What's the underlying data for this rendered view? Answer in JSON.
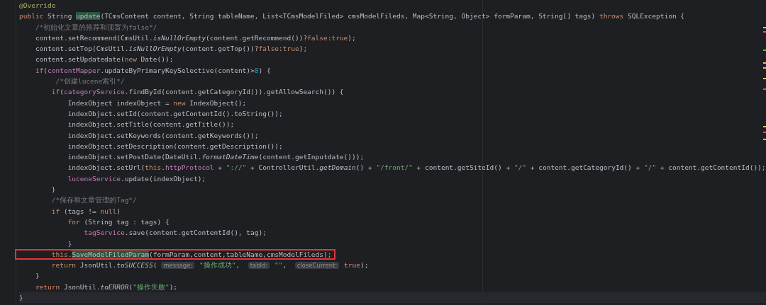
{
  "editor": {
    "lines": [
      {
        "boxed": false,
        "tokens": [
          {
            "kind": "annotation",
            "text": "@Override"
          }
        ]
      },
      {
        "boxed": false,
        "tokens": [
          {
            "kind": "keyword",
            "text": "public "
          },
          {
            "kind": "plain",
            "text": "String "
          },
          {
            "kind": "match",
            "text": "update"
          },
          {
            "kind": "plain",
            "text": "(TCmsContent content, String tableName, List<TCmsModelFiled> cmsModelFileds, Map<String, Object> formParam, String[] tags) "
          },
          {
            "kind": "keyword",
            "text": "throws "
          },
          {
            "kind": "plain",
            "text": "SQLException {"
          }
        ]
      },
      {
        "boxed": false,
        "tokens": [
          {
            "kind": "comment",
            "text": "    /*初始化文章的推荐和顶置为false*/"
          }
        ]
      },
      {
        "boxed": false,
        "tokens": [
          {
            "kind": "plain",
            "text": "    content.setRecommend(CmsUtil."
          },
          {
            "kind": "static",
            "text": "isNullOrEmpty"
          },
          {
            "kind": "plain",
            "text": "(content.getRecommend())?"
          },
          {
            "kind": "keyword",
            "text": "false"
          },
          {
            "kind": "plain",
            "text": ":"
          },
          {
            "kind": "keyword",
            "text": "true"
          },
          {
            "kind": "plain",
            "text": ");"
          }
        ]
      },
      {
        "boxed": false,
        "tokens": [
          {
            "kind": "plain",
            "text": "    content.setTop(CmsUtil."
          },
          {
            "kind": "static",
            "text": "isNullOrEmpty"
          },
          {
            "kind": "plain",
            "text": "(content.getTop())?"
          },
          {
            "kind": "keyword",
            "text": "false"
          },
          {
            "kind": "plain",
            "text": ":"
          },
          {
            "kind": "keyword",
            "text": "true"
          },
          {
            "kind": "plain",
            "text": ");"
          }
        ]
      },
      {
        "boxed": false,
        "tokens": [
          {
            "kind": "plain",
            "text": "    content.setUpdatedate("
          },
          {
            "kind": "keyword",
            "text": "new "
          },
          {
            "kind": "plain",
            "text": "Date());"
          }
        ]
      },
      {
        "boxed": false,
        "tokens": [
          {
            "kind": "keyword",
            "text": "    if"
          },
          {
            "kind": "plain",
            "text": "("
          },
          {
            "kind": "field",
            "text": "contentMapper"
          },
          {
            "kind": "plain",
            "text": ".updateByPrimaryKeySelective(content)>"
          },
          {
            "kind": "number",
            "text": "0"
          },
          {
            "kind": "plain",
            "text": ") {"
          }
        ]
      },
      {
        "boxed": false,
        "tokens": [
          {
            "kind": "comment",
            "text": "         /*创建lucene索引*/"
          }
        ]
      },
      {
        "boxed": false,
        "tokens": [
          {
            "kind": "keyword",
            "text": "        if"
          },
          {
            "kind": "plain",
            "text": "("
          },
          {
            "kind": "field",
            "text": "categoryService"
          },
          {
            "kind": "plain",
            "text": ".findById(content.getCategoryId()).getAllowSearch()) {"
          }
        ]
      },
      {
        "boxed": false,
        "tokens": [
          {
            "kind": "plain",
            "text": "            IndexObject indexObject = "
          },
          {
            "kind": "keyword",
            "text": "new "
          },
          {
            "kind": "plain",
            "text": "IndexObject();"
          }
        ]
      },
      {
        "boxed": false,
        "tokens": [
          {
            "kind": "plain",
            "text": "            indexObject.setId(content.getContentId().toString());"
          }
        ]
      },
      {
        "boxed": false,
        "tokens": [
          {
            "kind": "plain",
            "text": "            indexObject.setTitle(content.getTitle());"
          }
        ]
      },
      {
        "boxed": false,
        "tokens": [
          {
            "kind": "plain",
            "text": "            indexObject.setKeywords(content.getKeywords());"
          }
        ]
      },
      {
        "boxed": false,
        "tokens": [
          {
            "kind": "plain",
            "text": "            indexObject.setDescription(content.getDescription());"
          }
        ]
      },
      {
        "boxed": false,
        "tokens": [
          {
            "kind": "plain",
            "text": "            indexObject.setPostDate(DateUtil."
          },
          {
            "kind": "static",
            "text": "formatDateTime"
          },
          {
            "kind": "plain",
            "text": "(content.getInputdate()));"
          }
        ]
      },
      {
        "boxed": false,
        "tokens": [
          {
            "kind": "plain",
            "text": "            indexObject.setUrl("
          },
          {
            "kind": "keyword",
            "text": "this"
          },
          {
            "kind": "plain",
            "text": "."
          },
          {
            "kind": "field",
            "text": "httpProtocol"
          },
          {
            "kind": "plain",
            "text": " + "
          },
          {
            "kind": "string",
            "text": "\"://\""
          },
          {
            "kind": "plain",
            "text": " + ControllerUtil."
          },
          {
            "kind": "static",
            "text": "getDomain"
          },
          {
            "kind": "plain",
            "text": "() + "
          },
          {
            "kind": "string",
            "text": "\"/front/\""
          },
          {
            "kind": "plain",
            "text": " + content.getSiteId() + "
          },
          {
            "kind": "string",
            "text": "\"/\""
          },
          {
            "kind": "plain",
            "text": " + content.getCategoryId() + "
          },
          {
            "kind": "string",
            "text": "\"/\""
          },
          {
            "kind": "plain",
            "text": " + content.getContentId());"
          }
        ]
      },
      {
        "boxed": false,
        "tokens": [
          {
            "kind": "field",
            "text": "            luceneService"
          },
          {
            "kind": "plain",
            "text": ".update(indexObject);"
          }
        ]
      },
      {
        "boxed": false,
        "tokens": [
          {
            "kind": "plain",
            "text": "        }"
          }
        ]
      },
      {
        "boxed": false,
        "tokens": [
          {
            "kind": "comment",
            "text": "        /*保存和文章管理的Tag*/"
          }
        ]
      },
      {
        "boxed": false,
        "tokens": [
          {
            "kind": "keyword",
            "text": "        if "
          },
          {
            "kind": "plain",
            "text": "(tags != "
          },
          {
            "kind": "keyword",
            "text": "null"
          },
          {
            "kind": "plain",
            "text": ")"
          }
        ]
      },
      {
        "boxed": false,
        "tokens": [
          {
            "kind": "keyword",
            "text": "            for "
          },
          {
            "kind": "plain",
            "text": "(String tag : tags) {"
          }
        ]
      },
      {
        "boxed": false,
        "tokens": [
          {
            "kind": "field",
            "text": "                tagService"
          },
          {
            "kind": "plain",
            "text": ".save(content.getContentId(), tag);"
          }
        ]
      },
      {
        "boxed": false,
        "tokens": [
          {
            "kind": "plain",
            "text": "            }"
          }
        ]
      },
      {
        "boxed": true,
        "tokens": [
          {
            "kind": "keyword",
            "text": "        this"
          },
          {
            "kind": "plain",
            "text": "."
          },
          {
            "kind": "match",
            "text": "SaveModelFiledParam"
          },
          {
            "kind": "plain",
            "text": "(formParam,content,tableName,cmsModelFileds);"
          }
        ]
      },
      {
        "boxed": false,
        "tokens": [
          {
            "kind": "keyword",
            "text": "        return "
          },
          {
            "kind": "plain",
            "text": "JsonUtil."
          },
          {
            "kind": "static",
            "text": "toSUCCESS"
          },
          {
            "kind": "plain",
            "text": "( "
          },
          {
            "kind": "hint",
            "text": "message:"
          },
          {
            "kind": "string",
            "text": " \"操作成功\""
          },
          {
            "kind": "plain",
            "text": ",  "
          },
          {
            "kind": "hint",
            "text": "tabId:"
          },
          {
            "kind": "string",
            "text": " \"\""
          },
          {
            "kind": "plain",
            "text": ",  "
          },
          {
            "kind": "hint",
            "text": "closeCurrent:"
          },
          {
            "kind": "keyword",
            "text": " true"
          },
          {
            "kind": "plain",
            "text": ");"
          }
        ]
      },
      {
        "boxed": false,
        "tokens": [
          {
            "kind": "plain",
            "text": "    }"
          }
        ]
      },
      {
        "boxed": false,
        "tokens": [
          {
            "kind": "keyword",
            "text": "    return "
          },
          {
            "kind": "plain",
            "text": "JsonUtil."
          },
          {
            "kind": "static",
            "text": "toERROR"
          },
          {
            "kind": "plain",
            "text": "("
          },
          {
            "kind": "string",
            "text": "\"操作失败\""
          },
          {
            "kind": "plain",
            "text": ");"
          }
        ]
      },
      {
        "boxed": false,
        "tokens": [
          {
            "kind": "plain",
            "text": "}"
          }
        ]
      }
    ]
  }
}
